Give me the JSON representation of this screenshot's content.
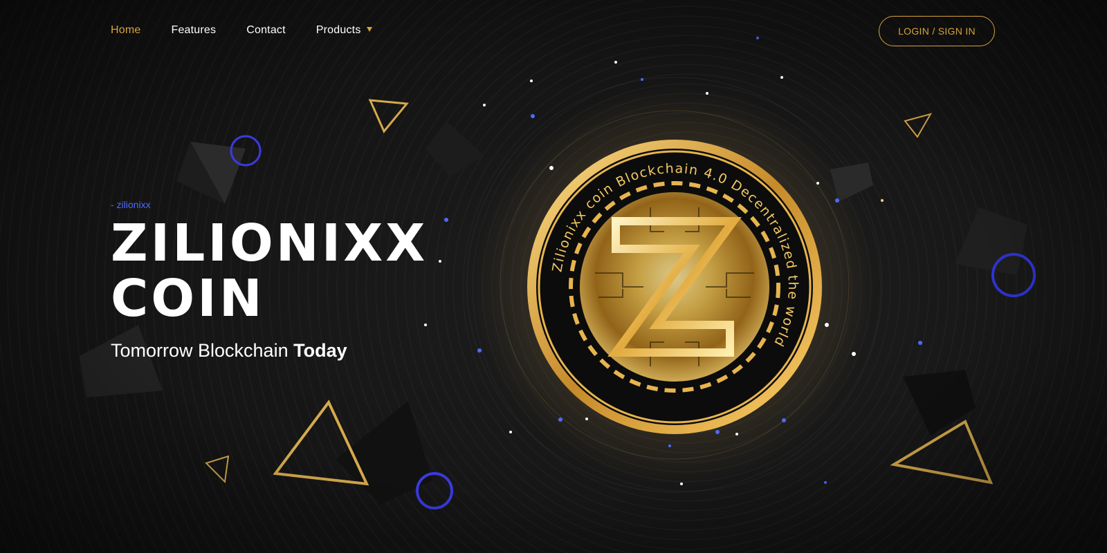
{
  "nav": {
    "items": [
      {
        "label": "Home",
        "active": true
      },
      {
        "label": "Features",
        "active": false
      },
      {
        "label": "Contact",
        "active": false
      },
      {
        "label": "Products",
        "active": false,
        "has_dropdown": true
      }
    ],
    "login_label": "LOGIN / SIGN IN"
  },
  "hero": {
    "eyebrow": "- zilionixx",
    "title_line1": "ZILIONIXX",
    "title_line2": "COIN",
    "tagline_regular": "Tomorrow Blockchain",
    "tagline_bold": "Today"
  },
  "coin": {
    "ring_text": "Zilionixx coin Blockchain 4.0 Decentralized the world",
    "center_letter": "Z"
  },
  "colors": {
    "background": "#141414",
    "accent_gold": "#d8a33c",
    "accent_blue": "#4d6bff",
    "ring_purple": "#3a3ae0"
  }
}
